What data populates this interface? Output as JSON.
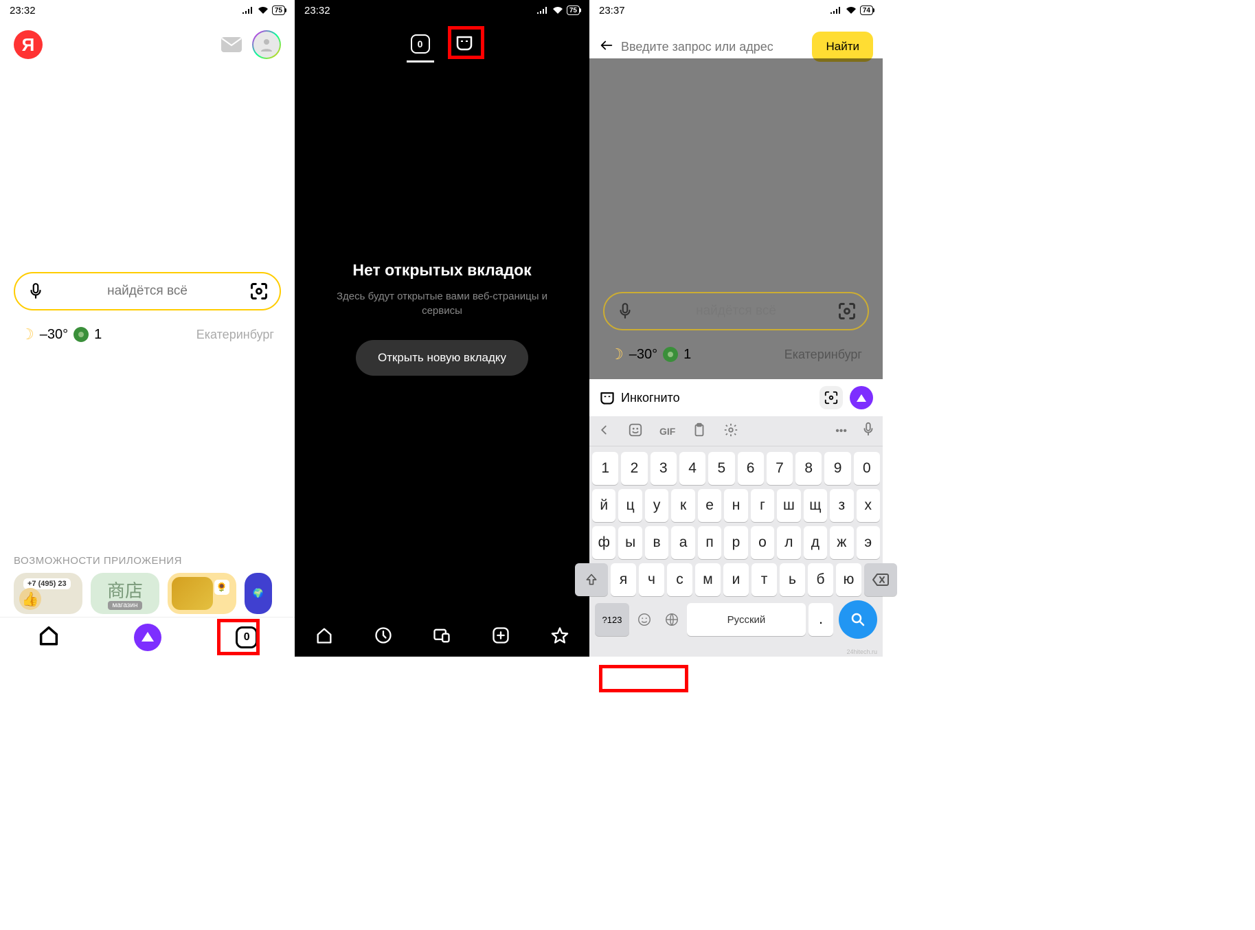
{
  "status": {
    "time1": "23:32",
    "time2": "23:32",
    "time3": "23:37",
    "batt12": "75",
    "batt3": "74"
  },
  "screen1": {
    "logo": "Я",
    "search_placeholder": "найдётся всё",
    "temp": "–30°",
    "aqi": "1",
    "city": "Екатеринбург",
    "section": "ВОЗМОЖНОСТИ ПРИЛОЖЕНИЯ",
    "app1_phone": "+7 (495) 23",
    "app2_cn": "商店",
    "app2_tag": "магазин",
    "tabs_count": "0"
  },
  "screen2": {
    "tabs_count": "0",
    "title": "Нет открытых вкладок",
    "subtitle": "Здесь будут открытые вами веб-страницы и сервисы",
    "button": "Открыть новую вкладку"
  },
  "screen3": {
    "search_placeholder": "Введите запрос или адрес",
    "find": "Найти",
    "dim_search_placeholder": "найдётся всё",
    "dim_temp": "–30°",
    "dim_aqi": "1",
    "dim_city": "Екатеринбург",
    "incognito": "Инкогнито",
    "gif": "GIF",
    "row_num": [
      "1",
      "2",
      "3",
      "4",
      "5",
      "6",
      "7",
      "8",
      "9",
      "0"
    ],
    "row_a": [
      "й",
      "ц",
      "у",
      "к",
      "е",
      "н",
      "г",
      "ш",
      "щ",
      "з",
      "х"
    ],
    "row_b": [
      "ф",
      "ы",
      "в",
      "а",
      "п",
      "р",
      "о",
      "л",
      "д",
      "ж",
      "э"
    ],
    "row_c": [
      "я",
      "ч",
      "с",
      "м",
      "и",
      "т",
      "ь",
      "б",
      "ю"
    ],
    "sym": "?123",
    "space": "Русский"
  },
  "watermark": "24hitech.ru"
}
